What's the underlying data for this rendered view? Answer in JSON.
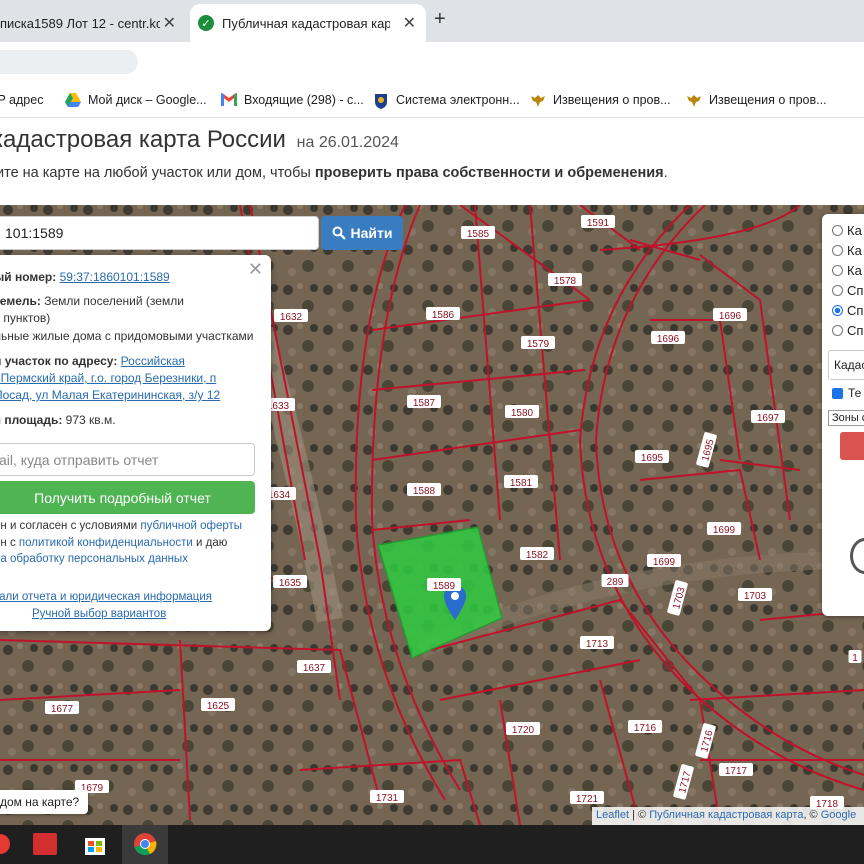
{
  "browser": {
    "tabs": [
      {
        "title": "писка1589 Лот 12 - centr.ko"
      },
      {
        "title": "Публичная кадастровая карта"
      }
    ],
    "new_tab": "+",
    "tab_close": "✕",
    "tab_check": "✓"
  },
  "bookmarks": [
    {
      "label": "IP адрес",
      "icon": "globe-icon"
    },
    {
      "label": "Мой диск – Google...",
      "icon": "google-drive-icon"
    },
    {
      "label": "Входящие (298) - с...",
      "icon": "gmail-icon"
    },
    {
      "label": "Система электронн...",
      "icon": "emblem-icon"
    },
    {
      "label": "Извещения о пров...",
      "icon": "eagle-icon"
    },
    {
      "label": "Извещения о пров...",
      "icon": "eagle-icon"
    }
  ],
  "header": {
    "title": "кадастровая карта России",
    "date_prefix": "на",
    "date": "26.01.2024",
    "subtitle_start": "ите на карте на любой участок или дом, чтобы",
    "subtitle_bold": "проверить права собственности и обременения",
    "subtitle_end": "."
  },
  "search": {
    "value": "101:1589",
    "button": "Найти"
  },
  "popup": {
    "close": "✕",
    "cad_label": "ый номер:",
    "cad_value": "59:37:1860101:1589",
    "land_label": "земель:",
    "land_value1": "Земли поселений (земли",
    "land_value2": "х пунктов)",
    "land_use": "льные жилые дома с придомовыми участками",
    "addr_label": "й участок по адресу:",
    "addr_line1": "Российская",
    "addr_line2": ", Пермский край, г.о. город Березники, п",
    "addr_line3": "Посад, ул Малая Екатерининская, з/у 12",
    "area_label": "я площадь:",
    "area_value": "973 кв.м.",
    "email_placeholder": "ail, куда отправить отчет",
    "report_button": "Получить подробный отчет",
    "terms1_a": "ен и согласен с условиями",
    "terms1_link": "публичной оферты",
    "terms2_a": "ен с",
    "terms2_link": "политикой конфиденциальности",
    "terms2_b": "и даю",
    "terms3_link": "на обработку персональных данных",
    "details_link": "тали отчета и юридическая информация",
    "manual_link": "Ручной выбор вариантов"
  },
  "right_panel": {
    "options": [
      "Ка",
      "Ка",
      "Ка",
      "Сп",
      "Сп",
      "Сп"
    ],
    "selected_index": 4,
    "select_value": "Кадаст",
    "checkbox_label": "Те",
    "zones_label": "Зоны с"
  },
  "map": {
    "parcel_labels": [
      "1585",
      "1591",
      "1578",
      "1586",
      "1579",
      "1632",
      "1696",
      "1696",
      "1587",
      "1580",
      "1633",
      "1697",
      "1695",
      "1695",
      "1588",
      "1581",
      "1634",
      "1699",
      "1582",
      "1699",
      "1589",
      "289",
      "1635",
      "1703",
      "1703",
      "1713",
      "1637",
      "1677",
      "1625",
      "1716",
      "1720",
      "1716",
      "1717",
      "1679",
      "1731",
      "1721",
      "1717",
      "1718",
      "1"
    ],
    "selected_parcel": "1589",
    "help_button": "дом на карте?",
    "attribution": {
      "leaflet": "Leaflet",
      "sep": "| ©",
      "pkk": "Публичная кадастровая карта",
      "sep2": ", ©",
      "google": "Google"
    }
  },
  "colors": {
    "parcel_fill": "#2ecc40",
    "boundary": "#c0122b",
    "find_button": "#3a7cc0",
    "report_button": "#4fb553",
    "marker": "#2a6bd0"
  }
}
